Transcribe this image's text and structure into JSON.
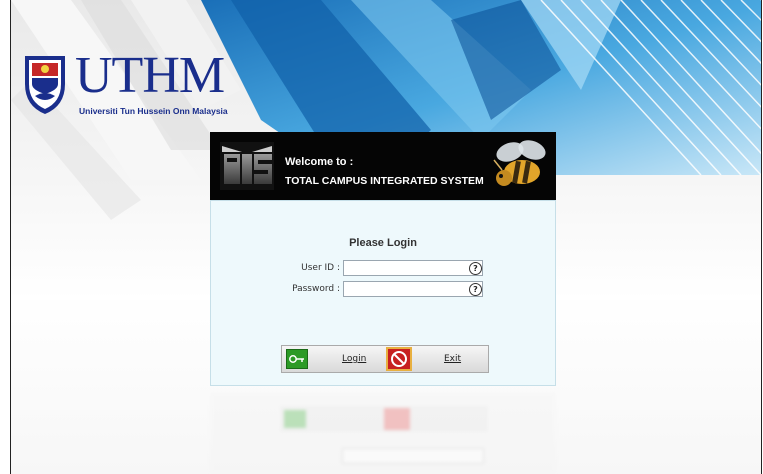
{
  "brand": {
    "logo_text": "UTHM",
    "university_name": "Universiti Tun Hussein Onn Malaysia"
  },
  "banner": {
    "welcome": "Welcome to :",
    "system_name": "TOTAL CAMPUS INTEGRATED SYSTEM",
    "logo_icon": "tis-logo-icon",
    "mascot_icon": "bee-icon"
  },
  "login": {
    "heading": "Please Login",
    "user_id_label": "User ID :",
    "user_id_value": "",
    "password_label": "Password :",
    "password_value": "",
    "help_glyph": "?",
    "login_label": "Login",
    "exit_label": "Exit"
  },
  "colors": {
    "brand_blue": "#1a2e8c",
    "banner_bg": "#050505",
    "form_bg": "#eef9fc",
    "login_green": "#2c9a26",
    "exit_red": "#c72020"
  }
}
